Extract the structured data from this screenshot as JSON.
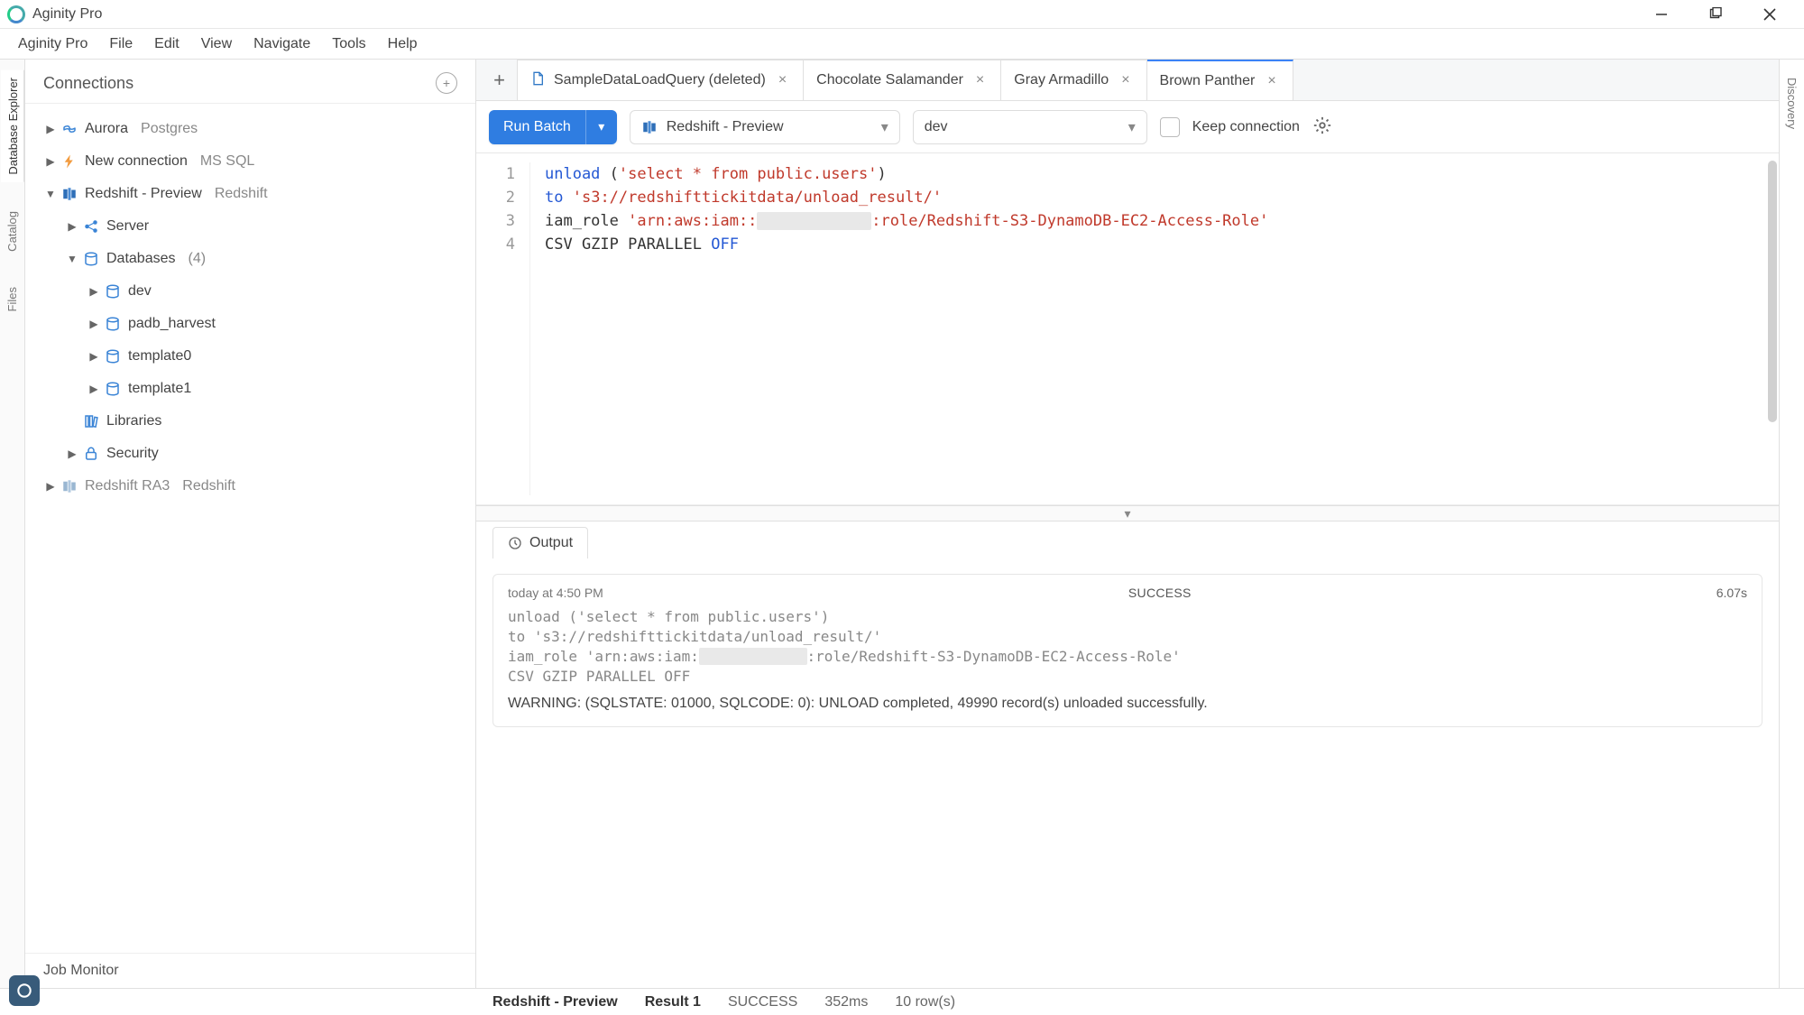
{
  "app": {
    "title": "Aginity Pro"
  },
  "menus": [
    "Aginity Pro",
    "File",
    "Edit",
    "View",
    "Navigate",
    "Tools",
    "Help"
  ],
  "left_rails": [
    "Database Explorer",
    "Catalog",
    "Files"
  ],
  "right_rails": [
    "Discovery"
  ],
  "connections": {
    "title": "Connections",
    "items": [
      {
        "name": "Aurora",
        "type": "Postgres",
        "icon": "aurora"
      },
      {
        "name": "New connection",
        "type": "MS SQL",
        "icon": "bolt"
      },
      {
        "name": "Redshift - Preview",
        "type": "Redshift",
        "icon": "redshift",
        "expanded": true,
        "children": [
          {
            "name": "Server",
            "icon": "share"
          },
          {
            "name": "Databases",
            "count": "(4)",
            "icon": "db",
            "expanded": true,
            "children": [
              {
                "name": "dev",
                "icon": "db"
              },
              {
                "name": "padb_harvest",
                "icon": "db"
              },
              {
                "name": "template0",
                "icon": "db"
              },
              {
                "name": "template1",
                "icon": "db"
              }
            ]
          },
          {
            "name": "Libraries",
            "icon": "library"
          },
          {
            "name": "Security",
            "icon": "lock"
          }
        ]
      },
      {
        "name": "Redshift RA3",
        "type": "Redshift",
        "icon": "redshift-dim"
      }
    ],
    "foot": "Job Monitor"
  },
  "tabs": [
    {
      "label": "SampleDataLoadQuery (deleted)",
      "file_icon": true
    },
    {
      "label": "Chocolate Salamander"
    },
    {
      "label": "Gray Armadillo"
    },
    {
      "label": "Brown Panther",
      "active": true
    }
  ],
  "toolbar": {
    "run_label": "Run Batch",
    "connection": "Redshift - Preview",
    "database": "dev",
    "keep_label": "Keep connection"
  },
  "code": {
    "lines": [
      "1",
      "2",
      "3",
      "4"
    ],
    "l1_kw": "unload",
    "l1_a": " (",
    "l1_str": "'select * from public.users'",
    "l1_b": ")",
    "l2_kw": "to",
    "l2_sp": " ",
    "l2_str": "'s3://redshifttickitdata/unload_result/'",
    "l3_a": "iam_role ",
    "l3_str1": "'arn:aws:iam::",
    "l3_redact": "XXXXXXXXXXXX",
    "l3_str2": ":role/Redshift-S3-DynamoDB-EC2-Access-Role'",
    "l4_a": "CSV GZIP PARALLEL ",
    "l4_off": "OFF"
  },
  "output": {
    "tab_label": "Output",
    "timestamp": "today at 4:50 PM",
    "status": "SUCCESS",
    "duration": "6.07s",
    "log_l1": "unload ('select * from public.users')",
    "log_l2": "to 's3://redshifttickitdata/unload_result/'",
    "log_l3a": "iam_role 'arn:aws:iam:",
    "log_l3_redact": "XXXXXXXXXXXX",
    "log_l3b": ":role/Redshift-S3-DynamoDB-EC2-Access-Role'",
    "log_l4": "CSV GZIP PARALLEL OFF",
    "warning": "WARNING: (SQLSTATE: 01000, SQLCODE: 0): UNLOAD completed, 49990 record(s) unloaded successfully."
  },
  "status": {
    "conn": "Redshift - Preview",
    "result": "Result 1",
    "state": "SUCCESS",
    "time": "352ms",
    "rows": "10 row(s)"
  }
}
